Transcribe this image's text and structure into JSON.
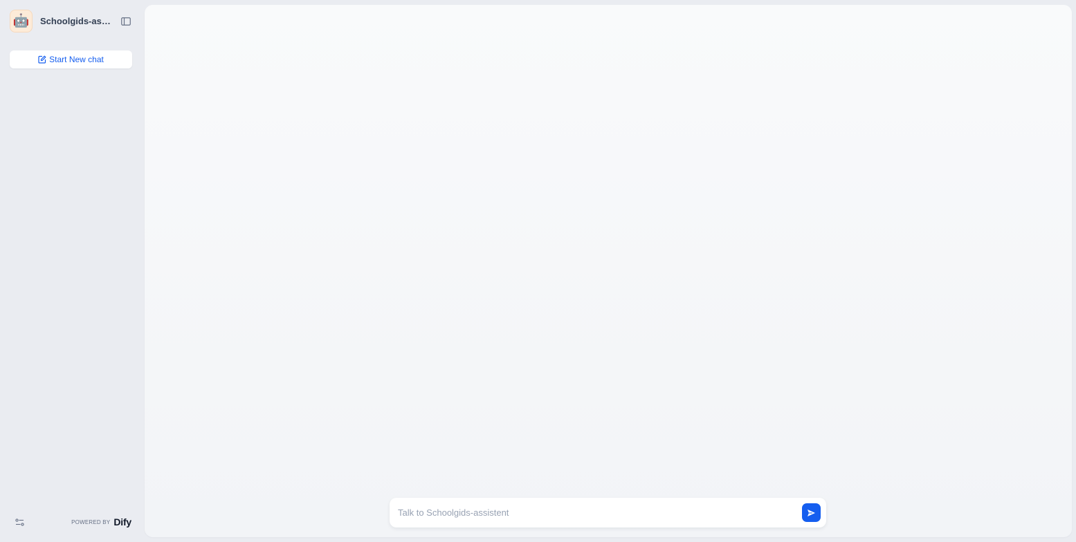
{
  "app": {
    "name": "Schoolgids-assi...",
    "avatar_emoji": "🤖"
  },
  "sidebar": {
    "new_chat_label": "Start New chat",
    "collapse_icon": "panel-left-icon",
    "settings_icon": "sliders-icon"
  },
  "footer": {
    "powered_by": "POWERED BY",
    "brand": "Dify"
  },
  "chat": {
    "input_placeholder": "Talk to Schoolgids-assistent",
    "input_value": "",
    "send_icon": "send-icon"
  },
  "colors": {
    "accent": "#155eef",
    "sidebar_bg": "#eaecf1",
    "avatar_bg": "#fdebd8"
  }
}
